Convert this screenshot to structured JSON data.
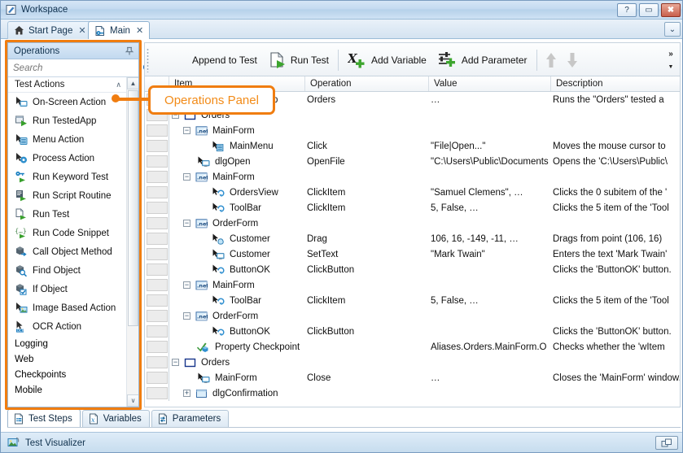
{
  "window": {
    "title": "Workspace",
    "icon": "workspace-icon",
    "buttons": {
      "help": "?",
      "restore": "▭",
      "close": "✖"
    }
  },
  "doc_tabs": [
    {
      "label": "Start Page",
      "icon": "home-icon",
      "close": "✕",
      "active": false
    },
    {
      "label": "Main",
      "icon": "keyword-test-icon",
      "close": "✕",
      "active": true
    }
  ],
  "tabstrip": {
    "overflow_label": "⌄"
  },
  "operations_panel": {
    "title": "Operations",
    "pin_icon": "pin-icon",
    "search": {
      "value": "",
      "placeholder": "Search",
      "icon": "search-icon",
      "dropdown": "▼"
    },
    "group": {
      "label": "Test Actions",
      "collapse_icon": "∧"
    },
    "items": [
      {
        "label": "On-Screen Action",
        "icon": "on-screen-action-icon"
      },
      {
        "label": "Run TestedApp",
        "icon": "run-tested-app-icon"
      },
      {
        "label": "Menu Action",
        "icon": "menu-action-icon"
      },
      {
        "label": "Process Action",
        "icon": "process-action-icon"
      },
      {
        "label": "Run Keyword Test",
        "icon": "run-keyword-test-icon"
      },
      {
        "label": "Run Script Routine",
        "icon": "run-script-routine-icon"
      },
      {
        "label": "Run Test",
        "icon": "run-test-icon"
      },
      {
        "label": "Run Code Snippet",
        "icon": "run-code-snippet-icon"
      },
      {
        "label": "Call Object Method",
        "icon": "call-object-method-icon"
      },
      {
        "label": "Find Object",
        "icon": "find-object-icon"
      },
      {
        "label": "If Object",
        "icon": "if-object-icon"
      },
      {
        "label": "Image Based Action",
        "icon": "image-based-action-icon"
      },
      {
        "label": "OCR Action",
        "icon": "ocr-action-icon"
      }
    ],
    "categories": [
      {
        "label": "Logging"
      },
      {
        "label": "Web"
      },
      {
        "label": "Checkpoints"
      },
      {
        "label": "Mobile"
      }
    ],
    "scroll_down_icon": "∨"
  },
  "callout": {
    "text": "Operations Panel",
    "color": "#f07d10"
  },
  "toolbar": {
    "buttons": [
      {
        "label": "Append to Test",
        "icon": "append-to-test-icon",
        "truncated": true
      },
      {
        "label": "Run Test",
        "icon": "run-test-icon"
      },
      {
        "label": "Add Variable",
        "icon": "add-variable-icon"
      },
      {
        "label": "Add Parameter",
        "icon": "add-parameter-icon"
      }
    ],
    "move_up_icon": "arrow-up-icon",
    "move_down_icon": "arrow-down-icon",
    "overflow_chevrons": "»",
    "overflow_caret": "▼"
  },
  "grid": {
    "columns": [
      "Item",
      "Operation",
      "Value",
      "Description"
    ],
    "rows": [
      {
        "depth": 2,
        "expander": "",
        "icon": "run-tested-app-icon",
        "item": "Run TestedApp",
        "operation": "Orders",
        "value": "…",
        "description": "Runs the \"Orders\" tested a"
      },
      {
        "depth": 1,
        "expander": "-",
        "icon": "window-icon",
        "item": "Orders",
        "operation": "",
        "value": "",
        "description": ""
      },
      {
        "depth": 2,
        "expander": "-",
        "icon": "dotnet-icon",
        "item": "MainForm",
        "operation": "",
        "value": "",
        "description": ""
      },
      {
        "depth": 3,
        "expander": "",
        "icon": "menu-action-icon",
        "item": "MainMenu",
        "operation": "Click",
        "value": "\"File|Open...\"",
        "description": "Moves the mouse cursor to"
      },
      {
        "depth": 2,
        "expander": "",
        "icon": "on-screen-action-icon",
        "item": "dlgOpen",
        "operation": "OpenFile",
        "value": "\"C:\\Users\\Public\\Documents",
        "description": "Opens the 'C:\\Users\\Public\\"
      },
      {
        "depth": 2,
        "expander": "-",
        "icon": "dotnet-icon",
        "item": "MainForm",
        "operation": "",
        "value": "",
        "description": ""
      },
      {
        "depth": 3,
        "expander": "",
        "icon": "click-item-icon",
        "item": "OrdersView",
        "operation": "ClickItem",
        "value": "\"Samuel Clemens\", …",
        "description": "Clicks the 0 subitem of the '"
      },
      {
        "depth": 3,
        "expander": "",
        "icon": "click-item-icon",
        "item": "ToolBar",
        "operation": "ClickItem",
        "value": "5, False, …",
        "description": "Clicks the 5 item of the 'Tool"
      },
      {
        "depth": 2,
        "expander": "-",
        "icon": "dotnet-icon",
        "item": "OrderForm",
        "operation": "",
        "value": "",
        "description": ""
      },
      {
        "depth": 3,
        "expander": "",
        "icon": "drag-icon",
        "item": "Customer",
        "operation": "Drag",
        "value": "106, 16, -149, -11, …",
        "description": "Drags from point (106, 16)"
      },
      {
        "depth": 3,
        "expander": "",
        "icon": "on-screen-action-icon",
        "item": "Customer",
        "operation": "SetText",
        "value": "\"Mark Twain\"",
        "description": "Enters the text 'Mark Twain'"
      },
      {
        "depth": 3,
        "expander": "",
        "icon": "click-item-icon",
        "item": "ButtonOK",
        "operation": "ClickButton",
        "value": "",
        "description": "Clicks the 'ButtonOK' button."
      },
      {
        "depth": 2,
        "expander": "-",
        "icon": "dotnet-icon",
        "item": "MainForm",
        "operation": "",
        "value": "",
        "description": ""
      },
      {
        "depth": 3,
        "expander": "",
        "icon": "click-item-icon",
        "item": "ToolBar",
        "operation": "ClickItem",
        "value": "5, False, …",
        "description": "Clicks the 5 item of the 'Tool"
      },
      {
        "depth": 2,
        "expander": "-",
        "icon": "dotnet-icon",
        "item": "OrderForm",
        "operation": "",
        "value": "",
        "description": ""
      },
      {
        "depth": 3,
        "expander": "",
        "icon": "click-item-icon",
        "item": "ButtonOK",
        "operation": "ClickButton",
        "value": "",
        "description": "Clicks the 'ButtonOK' button."
      },
      {
        "depth": 2,
        "expander": "",
        "icon": "checkpoint-icon",
        "item": "Property Checkpoint",
        "operation": "",
        "value": "Aliases.Orders.MainForm.O",
        "description": "Checks whether the 'wItem"
      },
      {
        "depth": 1,
        "expander": "-",
        "icon": "window-icon",
        "item": "Orders",
        "operation": "",
        "value": "",
        "description": ""
      },
      {
        "depth": 2,
        "expander": "",
        "icon": "on-screen-action-icon",
        "item": "MainForm",
        "operation": "Close",
        "value": "…",
        "description": "Closes the 'MainForm' window."
      },
      {
        "depth": 2,
        "expander": "+",
        "icon": "dialog-icon",
        "item": "dlgConfirmation",
        "operation": "",
        "value": "",
        "description": ""
      }
    ]
  },
  "bottom_tabs": [
    {
      "label": "Test Steps",
      "icon": "test-steps-icon",
      "active": true
    },
    {
      "label": "Variables",
      "icon": "variables-icon",
      "active": false
    },
    {
      "label": "Parameters",
      "icon": "parameters-icon",
      "active": false
    }
  ],
  "statusbar": {
    "label": "Test Visualizer",
    "icon": "test-visualizer-icon",
    "corner_icon": "restore-panel-icon"
  }
}
